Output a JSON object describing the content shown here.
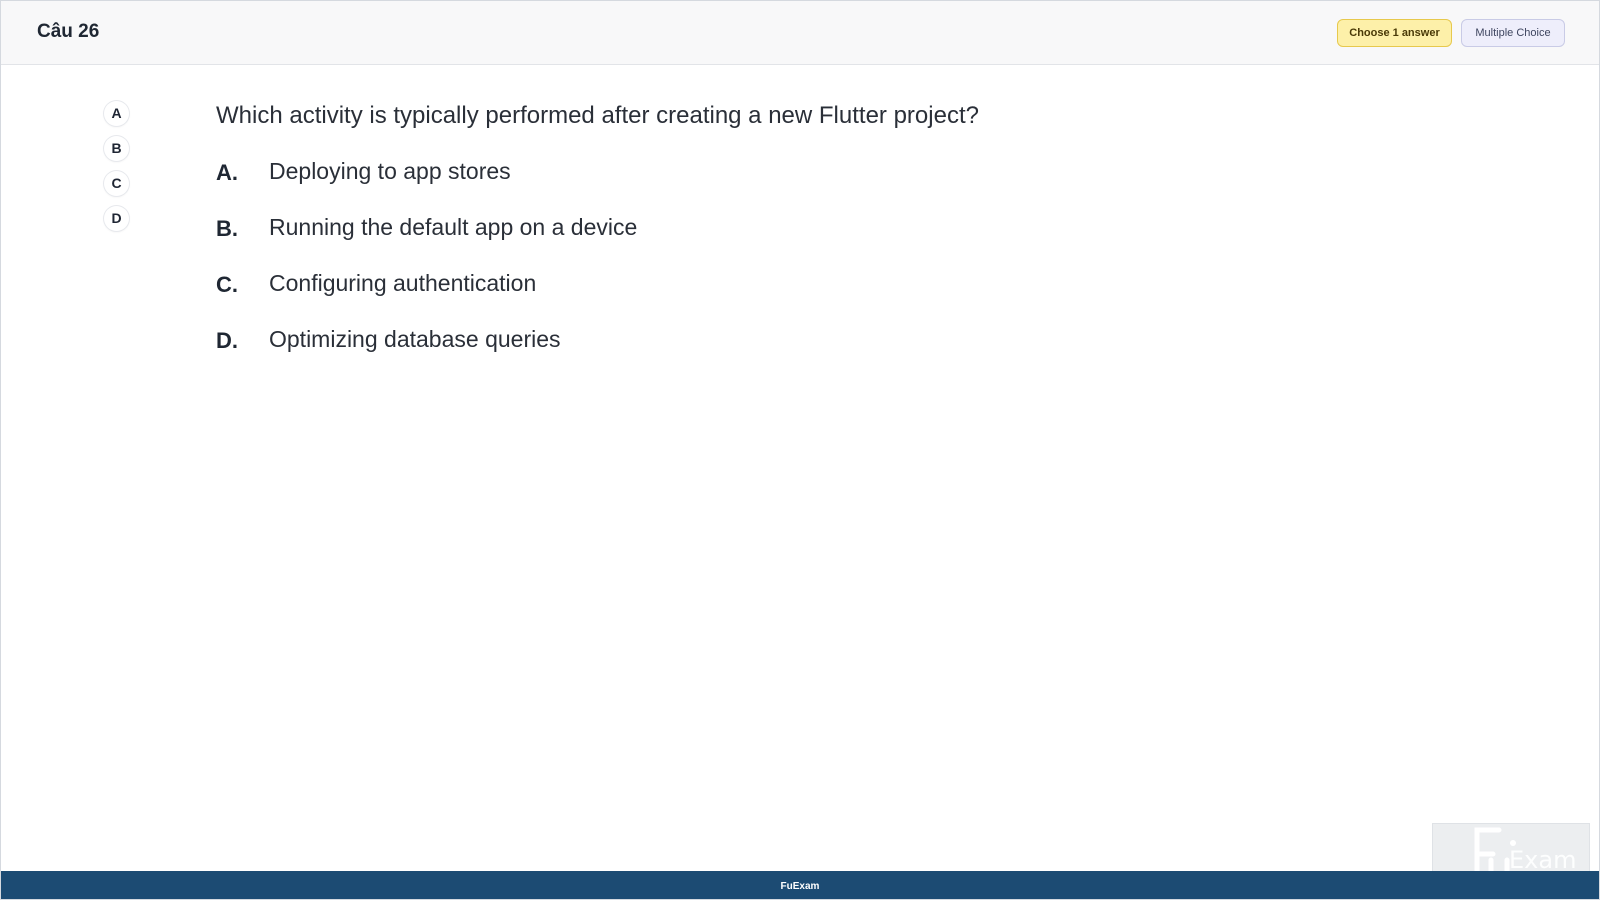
{
  "header": {
    "question_number": "Câu 26",
    "choose_badge": "Choose 1 answer",
    "type_badge": "Multiple Choice"
  },
  "sidebar": {
    "choices": [
      "A",
      "B",
      "C",
      "D"
    ]
  },
  "question": {
    "text": "Which activity is typically performed after creating a new Flutter project?"
  },
  "options": [
    {
      "letter": "A.",
      "text": "Deploying to app stores"
    },
    {
      "letter": "B.",
      "text": "Running the default app on a device"
    },
    {
      "letter": "C.",
      "text": "Configuring authentication"
    },
    {
      "letter": "D.",
      "text": "Optimizing database queries"
    }
  ],
  "watermark": {
    "logo_text": "Exam"
  },
  "footer": {
    "brand": "FuExam"
  },
  "colors": {
    "footer_bg": "#1c4b73",
    "choose_badge_bg": "#fdf0a9",
    "type_badge_bg": "#eeeefb"
  }
}
